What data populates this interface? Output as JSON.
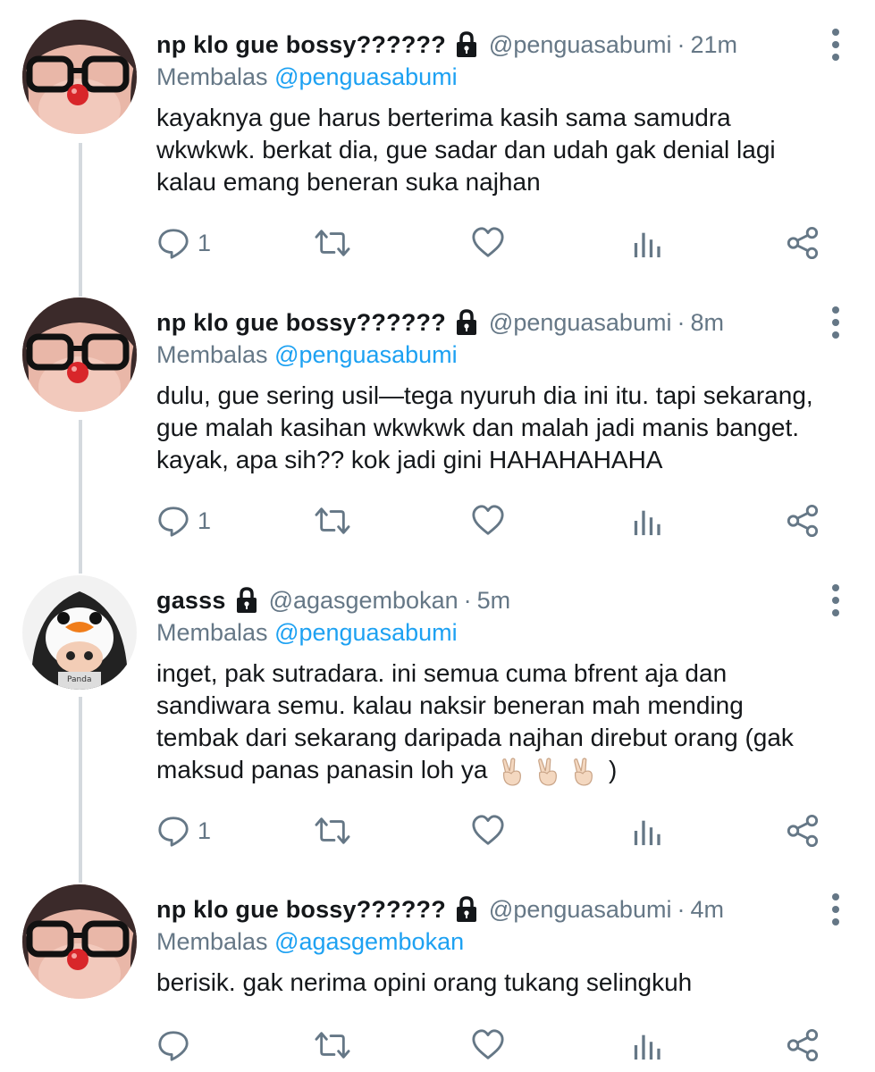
{
  "tweets": [
    {
      "name": "np klo gue bossy??????",
      "handle": "@penguasabumi",
      "sep": "·",
      "time": "21m",
      "reply_prefix": "Membalas",
      "reply_to": "@penguasabumi",
      "lines": [
        "kayaknya gue harus berterima kasih sama samudra",
        "wkwkwk. berkat dia, gue sadar dan udah gak denial lagi",
        "kalau emang beneran suka najhan"
      ],
      "reply_count": "1",
      "avatar": "glasses-doll-avatar"
    },
    {
      "name": "np klo gue bossy??????",
      "handle": "@penguasabumi",
      "sep": "·",
      "time": "8m",
      "reply_prefix": "Membalas",
      "reply_to": "@penguasabumi",
      "lines": [
        "dulu, gue sering usil—tega nyuruh dia ini itu. tapi sekarang,",
        "gue malah kasihan wkwkwk dan malah jadi manis banget.",
        "kayak, apa sih?? kok jadi gini HAHAHAHAHA"
      ],
      "reply_count": "1",
      "avatar": "glasses-doll-avatar"
    },
    {
      "name": "gasss",
      "handle": "@agasgembokan",
      "sep": "·",
      "time": "5m",
      "reply_prefix": "Membalas",
      "reply_to": "@penguasabumi",
      "lines": [
        "inget, pak sutradara. ini semua cuma bfrent aja dan",
        "sandiwara semu. kalau naksir beneran mah mending",
        "tembak dari sekarang daripada najhan direbut orang (gak",
        "maksud panas panasin loh ya"
      ],
      "line_end": ")",
      "reply_count": "1",
      "avatar": "penguin-costume-avatar",
      "avatar_text": "Panda"
    },
    {
      "name": "np klo gue bossy??????",
      "handle": "@penguasabumi",
      "sep": "·",
      "time": "4m",
      "reply_prefix": "Membalas",
      "reply_to": "@agasgembokan",
      "lines": [
        "berisik. gak nerima opini orang tukang selingkuh"
      ],
      "reply_count": "",
      "avatar": "glasses-doll-avatar"
    }
  ],
  "icons": {
    "lock": "lock-icon",
    "reply": "reply-icon",
    "retweet": "retweet-icon",
    "like": "heart-icon",
    "analytics": "analytics-icon",
    "share": "share-icon",
    "more": "more-vertical-icon",
    "emoji": "victory-hand-emoji"
  },
  "colors": {
    "text": "#14171a",
    "secondary": "#657786",
    "link": "#1da1f2",
    "thread_line": "#d4d9de"
  }
}
